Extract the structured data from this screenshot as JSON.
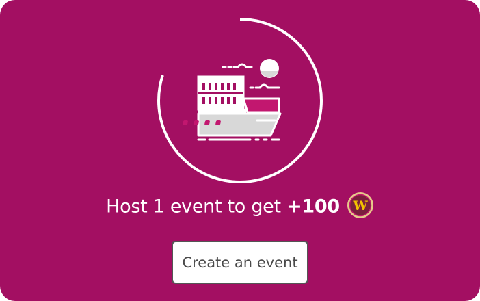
{
  "colors": {
    "card_background": "#a30f62",
    "accent_pink": "#c2176f",
    "ring": "#ffffff",
    "ship_gray": "#d8d8d8",
    "coin_rim": "#e7c98a",
    "coin_face": "#7a1f3d",
    "coin_letter": "#f2c200"
  },
  "progress": {
    "icon": "cruise-ship-icon",
    "completed_events": 0,
    "ring_fill_fraction": 0.8
  },
  "promo": {
    "text": "Host 1 event to get",
    "reward": "+100",
    "reward_icon": "w-coin-icon",
    "coin_letter": "W"
  },
  "actions": {
    "create_label": "Create an event"
  }
}
